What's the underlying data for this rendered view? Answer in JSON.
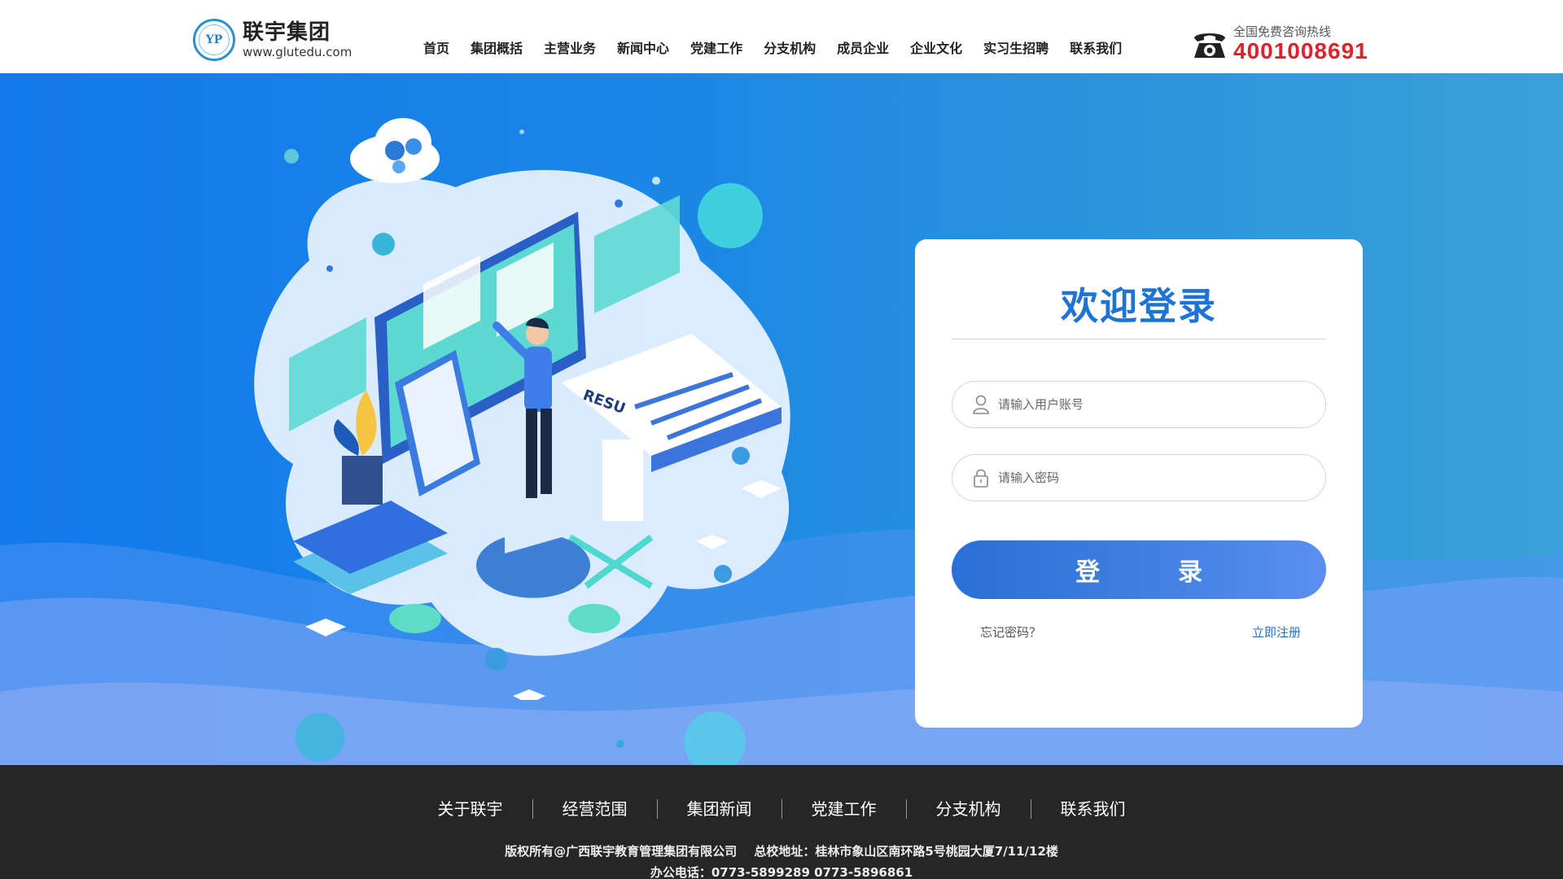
{
  "header": {
    "logo_name": "联宇集团",
    "logo_url": "www.glutedu.com",
    "logo_emblem": "YP",
    "nav": [
      {
        "label": "首页"
      },
      {
        "label": "集团概括"
      },
      {
        "label": "主营业务"
      },
      {
        "label": "新闻中心"
      },
      {
        "label": "党建工作"
      },
      {
        "label": "分支机构"
      },
      {
        "label": "成员企业"
      },
      {
        "label": "企业文化"
      },
      {
        "label": "实习生招聘"
      },
      {
        "label": "联系我们"
      }
    ],
    "hotline_label": "全国免费咨询热线",
    "hotline_number": "4001008691",
    "phone_icon": "telephone-icon"
  },
  "login": {
    "title": "欢迎登录",
    "username_placeholder": "请输入用户账号",
    "password_placeholder": "请输入密码",
    "username_icon": "user-icon",
    "password_icon": "lock-icon",
    "submit_label": "登录",
    "forgot_label": "忘记密码？",
    "register_label": "立即注册"
  },
  "illustration": {
    "resume_text": "RESU"
  },
  "footer": {
    "nav": [
      {
        "label": "关于联宇"
      },
      {
        "label": "经营范围"
      },
      {
        "label": "集团新闻"
      },
      {
        "label": "党建工作"
      },
      {
        "label": "分支机构"
      },
      {
        "label": "联系我们"
      }
    ],
    "copyright": "版权所有@广西联宇教育管理集团有限公司",
    "address": "总校地址：桂林市象山区南环路5号桃园大厦7/11/12楼",
    "office_phone": "办公电话：0773-5899289 0773-5896861"
  },
  "colors": {
    "accent": "#1e74d6",
    "hotline": "#e0202a",
    "hero_bg": "#1379ec",
    "footer_bg": "#262626"
  }
}
